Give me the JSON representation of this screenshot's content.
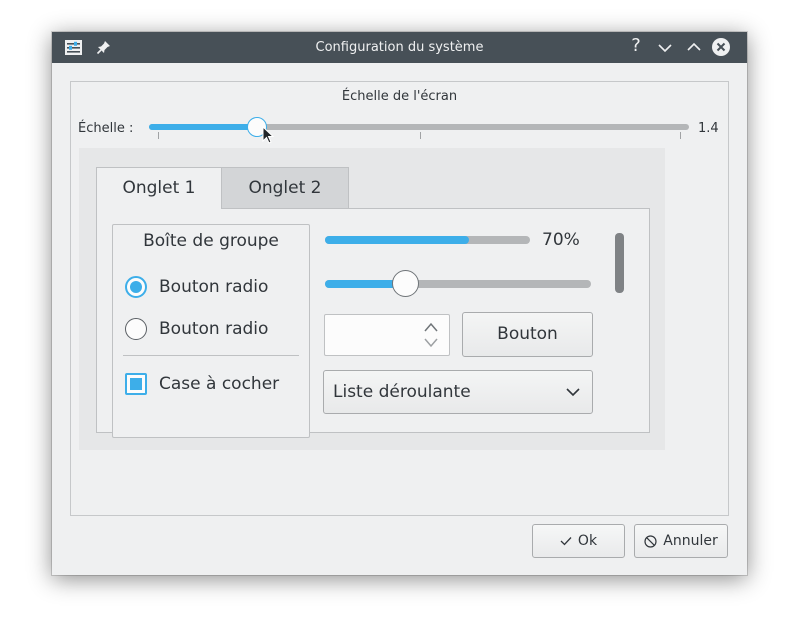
{
  "window": {
    "title": "Configuration du système",
    "help_label": "?"
  },
  "scale": {
    "heading": "Échelle de l'écran",
    "label": "Échelle :",
    "value_text": "1.4",
    "level_fraction": 0.2
  },
  "tabs": [
    {
      "label": "Onglet 1",
      "active": true
    },
    {
      "label": "Onglet 2",
      "active": false
    }
  ],
  "groupbox": {
    "title": "Boîte de groupe",
    "radio1_label": "Bouton radio",
    "radio1_checked": true,
    "radio2_label": "Bouton radio",
    "radio2_checked": false,
    "checkbox_label": "Case à cocher",
    "checkbox_checked": true
  },
  "progress": {
    "percent_value": 70,
    "text": "70%"
  },
  "slider": {
    "level_fraction": 0.3
  },
  "spinbox": {
    "value": ""
  },
  "push_button": {
    "label": "Bouton"
  },
  "combo": {
    "selected": "Liste déroulante"
  },
  "dialog_buttons": {
    "ok_label": "Ok",
    "cancel_label": "Annuler"
  },
  "colors": {
    "accent": "#3daee9",
    "titlebar": "#475057",
    "window_bg": "#eff0f1"
  }
}
